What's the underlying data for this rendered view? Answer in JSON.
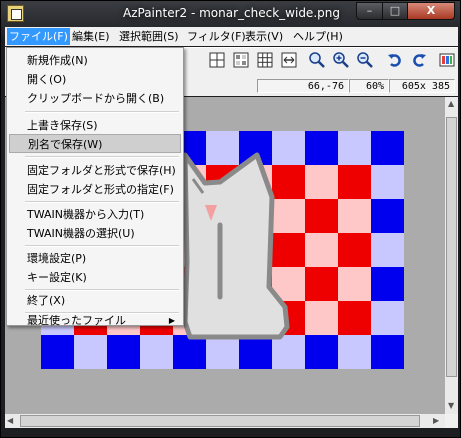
{
  "window": {
    "title": "AzPainter2 - monar_check_wide.png",
    "minimize_label": "–",
    "maximize_label": "□",
    "close_label": "X"
  },
  "menubar": {
    "items": [
      {
        "label": "ファイル(F)"
      },
      {
        "label": "編集(E)"
      },
      {
        "label": "選択範囲(S)"
      },
      {
        "label": "フィルタ(F)"
      },
      {
        "label": "表示(V)"
      },
      {
        "label": "ヘルプ(H)"
      }
    ]
  },
  "status": {
    "coords": "66,-76",
    "zoom": "60%",
    "size": "605x 385"
  },
  "toolbar_icons": [
    "grid-plus-icon",
    "checker-icon",
    "grid-icon",
    "fit-width-icon",
    "zoom-fit-icon",
    "zoom-in-icon",
    "zoom-out-icon",
    "undo-icon",
    "redo-icon",
    "app-extra-icon"
  ],
  "file_menu": {
    "items": [
      {
        "label": "新規作成(N)"
      },
      {
        "label": "開く(O)"
      },
      {
        "label": "クリップボードから開く(B)"
      },
      {
        "label": "上書き保存(S)"
      },
      {
        "label": "別名で保存(W)"
      },
      {
        "label": "固定フォルダと形式で保存(H)"
      },
      {
        "label": "固定フォルダと形式の指定(F)"
      },
      {
        "label": "TWAIN機器から入力(T)"
      },
      {
        "label": "TWAIN機器の選択(U)"
      },
      {
        "label": "環境設定(P)"
      },
      {
        "label": "キー設定(K)"
      },
      {
        "label": "終了(X)"
      },
      {
        "label": "最近使ったファイル"
      }
    ],
    "highlighted": "別名で保存(W)",
    "submenu_arrow": "▶"
  },
  "colors": {
    "checker_blue": "#0000ee",
    "checker_light_blue": "#c8c8ff",
    "checker_red": "#ee0000",
    "checker_pink": "#ffc8c8",
    "cat_fill": "#e0e0e0",
    "cat_outline": "#8a8a8a"
  }
}
